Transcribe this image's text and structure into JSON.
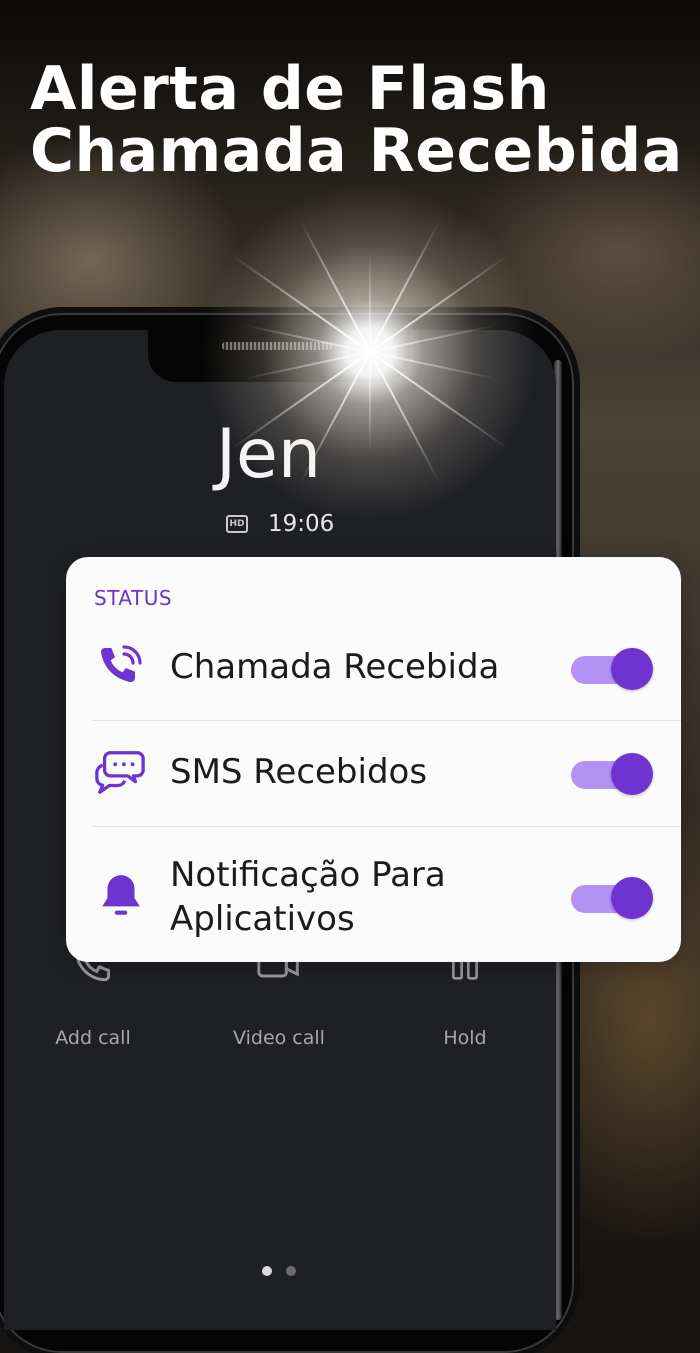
{
  "headline": {
    "line1": "Alerta de Flash",
    "line2": "Chamada Recebida"
  },
  "call_screen": {
    "caller_name": "Jen",
    "hd_badge": "HD",
    "call_time": "19:06",
    "actions": [
      {
        "label": "Add call",
        "icon": "add-call-icon"
      },
      {
        "label": "Video call",
        "icon": "video-call-icon"
      },
      {
        "label": "Hold",
        "icon": "hold-icon"
      }
    ],
    "page_indicator": {
      "pages": 2,
      "active": 1
    }
  },
  "status_card": {
    "title": "STATUS",
    "items": [
      {
        "label": "Chamada Recebida",
        "icon": "incoming-call-icon",
        "enabled": true
      },
      {
        "label": "SMS Recebidos",
        "icon": "chat-bubbles-icon",
        "enabled": true
      },
      {
        "label": "Notificação Para Aplicativos",
        "icon": "bell-icon",
        "enabled": true
      }
    ]
  },
  "colors": {
    "accent": "#6e33d0",
    "toggle_track": "#b391f5",
    "status_title": "#6c33cc",
    "card_background": "#fbfbfb",
    "phone_screen": "#1f2024"
  }
}
